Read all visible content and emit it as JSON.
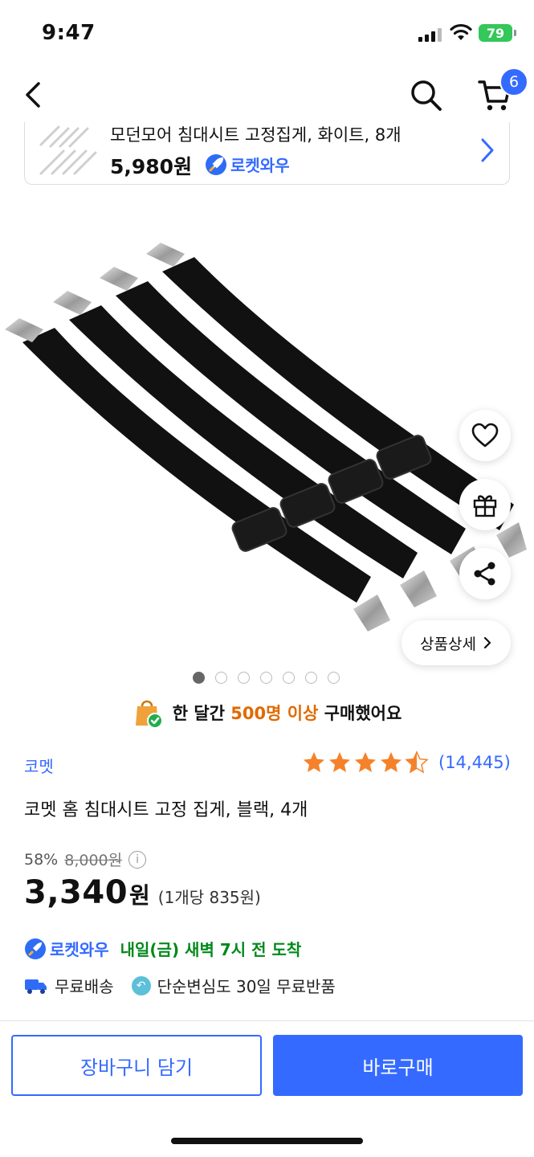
{
  "status_bar": {
    "time": "9:47",
    "battery": "79"
  },
  "nav": {
    "cart_count": "6"
  },
  "related": {
    "title": "모던모어 침대시트 고정집게, 화이트, 8개",
    "price": "5,980원",
    "rocket_label": "로켓와우"
  },
  "image_actions": {
    "detail_label": "상품상세"
  },
  "carousel": {
    "total": 7,
    "active_index": 0
  },
  "purchase_banner": {
    "before": "한 달간",
    "highlight": "500명 이상",
    "after": "구매했어요"
  },
  "product": {
    "brand": "코멧",
    "rating": 4.5,
    "review_count": "(14,445)",
    "title": "코멧 홈 침대시트 고정 집게, 블랙, 4개",
    "discount_rate": "58%",
    "original_price": "8,000원",
    "price": "3,340",
    "price_unit": "원",
    "unit_price": "(1개당 835원)"
  },
  "delivery": {
    "rocket_label": "로켓와우",
    "eta_prefix": "내일(금) 새벽",
    "eta_hour": "7",
    "eta_suffix": "시 전 도착",
    "free_shipping": "무료배송",
    "free_return": "단순변심도 30일 무료반품"
  },
  "cta": {
    "cart": "장바구니 담기",
    "buy": "바로구매"
  },
  "colors": {
    "accent": "#346aff",
    "orange": "#e06a00",
    "green": "#00891a",
    "star": "#f5822a"
  }
}
